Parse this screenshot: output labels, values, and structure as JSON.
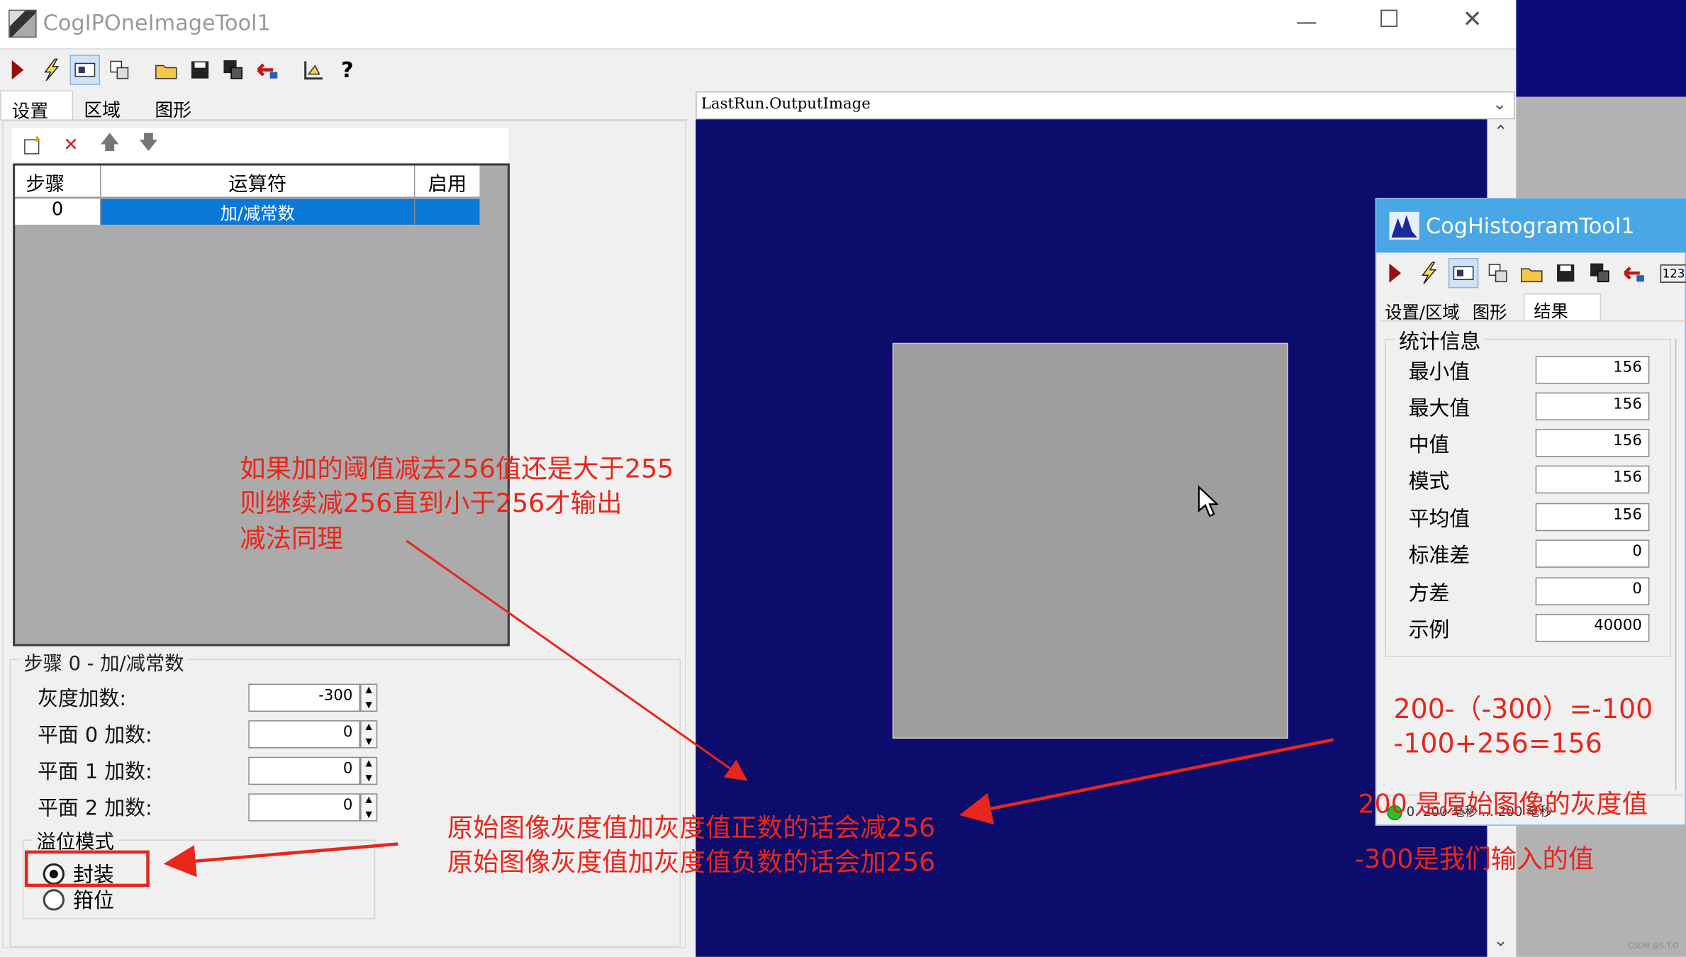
{
  "main_window": {
    "title": "CogIPOneImageTool1",
    "icon": "tool-app-icon",
    "controls": {
      "minimize": "—",
      "maximize": "☐",
      "close": "✕"
    },
    "toolbar_icons": [
      "run-icon",
      "electric-icon",
      "show-image-icon",
      "show-tool-icon",
      "open-icon",
      "save-icon",
      "save-as-icon",
      "reset-icon",
      "graphics-icon",
      "help-icon"
    ],
    "tabs": [
      "设置",
      "区域",
      "图形"
    ],
    "ops_toolbar_icons": [
      "new-step-icon",
      "delete-icon",
      "move-up-icon",
      "move-down-icon"
    ],
    "grid": {
      "headers": [
        "步骤",
        "运算符",
        "启用"
      ],
      "rows": [
        {
          "step": "0",
          "operator": "加/减常数",
          "enabled": ""
        }
      ]
    },
    "step_group_title": "步骤 0 - 加/减常数",
    "fields": [
      {
        "label": "灰度加数:",
        "value": "-300"
      },
      {
        "label": "平面 0 加数:",
        "value": "0"
      },
      {
        "label": "平面 1 加数:",
        "value": "0"
      },
      {
        "label": "平面 2 加数:",
        "value": "0"
      }
    ],
    "overflow_group": {
      "title": "溢位模式",
      "options": [
        "封装",
        "箝位"
      ],
      "selected": "封装"
    }
  },
  "image_display": {
    "selector_value": "LastRun.OutputImage",
    "background_color": "#0c0c6c",
    "image_fill_color": "#9e9e9e"
  },
  "histogram_window": {
    "title": "CogHistogramTool1",
    "tabs": [
      "设置/区域",
      "图形",
      "结果"
    ],
    "active_tab": "结果",
    "stats_group_title": "统计信息",
    "stats": [
      {
        "label": "最小值",
        "value": "156"
      },
      {
        "label": "最大值",
        "value": "156"
      },
      {
        "label": "中值",
        "value": "156"
      },
      {
        "label": "模式",
        "value": "156"
      },
      {
        "label": "平均值",
        "value": "156"
      },
      {
        "label": "标准差",
        "value": "0"
      },
      {
        "label": "方差",
        "value": "0"
      },
      {
        "label": "示例",
        "value": "40000"
      }
    ],
    "status_text": "0. 200 毫秒  ... 200 毫秒",
    "extra_toolbar_label": "123"
  },
  "annotations": {
    "note1": [
      "如果加的阈值减去256值还是大于255",
      "则继续减256直到小于256才输出",
      "减法同理"
    ],
    "note2": [
      "原始图像灰度值加灰度值正数的话会减256",
      "原始图像灰度值加灰度值负数的话会加256"
    ],
    "calc": [
      "200-（-300）=-100",
      "-100+256=156"
    ],
    "note3": "200 是原始图像的灰度值",
    "note4": "-300是我们输入的值",
    "watermark": "CSDN @S.T.O",
    "arrow_color": "#e8261c"
  }
}
